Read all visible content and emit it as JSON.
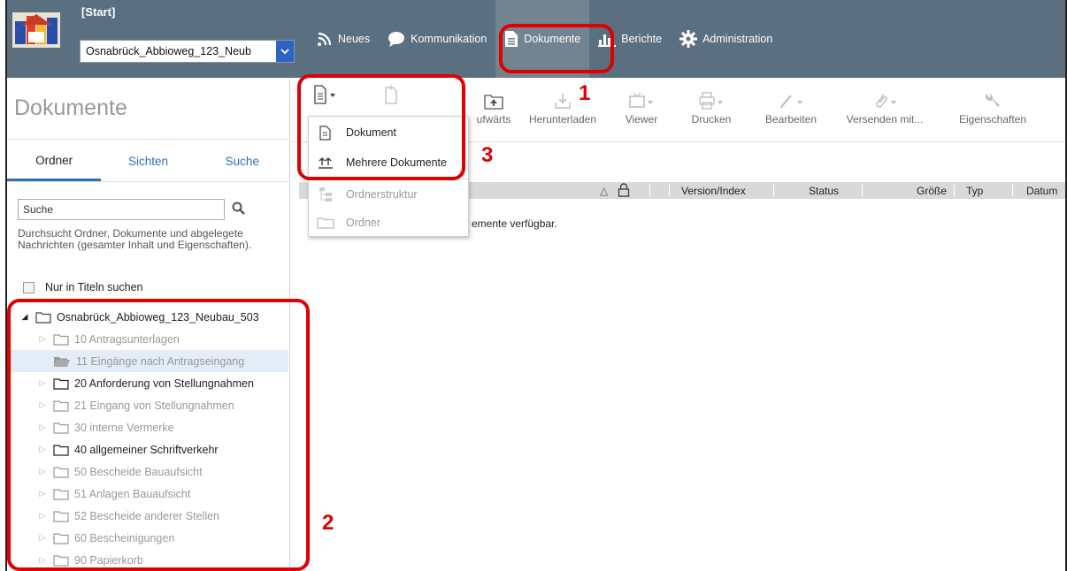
{
  "header": {
    "start_label": "[Start]",
    "project_select_value": "Osnabrück_Abbioweg_123_Neub",
    "nav": [
      {
        "label": "Neues",
        "icon": "rss-icon"
      },
      {
        "label": "Kommunikation",
        "icon": "speech-bubble-icon"
      },
      {
        "label": "Dokumente",
        "icon": "document-icon",
        "active": true
      },
      {
        "label": "Berichte",
        "icon": "bar-chart-icon"
      },
      {
        "label": "Administration",
        "icon": "gear-icon"
      }
    ]
  },
  "left_panel": {
    "title": "Dokumente",
    "tabs": [
      "Ordner",
      "Sichten",
      "Suche"
    ],
    "search_value": "Suche",
    "search_hint": "Durchsucht Ordner, Dokumente und abgelegete Nachrichten (gesamter Inhalt und Eigenschaften).",
    "title_only_label": "Nur in Titeln suchen",
    "tree": {
      "root": "Osnabrück_Abbioweg_123_Neubau_503",
      "children": [
        "10 Antragsunterlagen",
        "11 Eingänge nach Antragseingang",
        "20 Anforderung von Stellungnahmen",
        "21 Eingang von Stellungnahmen",
        "30 interne Vermerke",
        "40 allgemeiner Schriftverkehr",
        "50 Bescheide Bauaufsicht",
        "51 Anlagen Bauaufsicht",
        "52 Bescheide anderer Stellen",
        "60 Bescheinigungen",
        "90 Papierkorb"
      ]
    }
  },
  "toolbar": {
    "upload_label": "ufwärts",
    "download_label": "Herunterladen",
    "viewer_label": "Viewer",
    "print_label": "Drucken",
    "edit_label": "Bearbeiten",
    "send_label": "Versenden mit...",
    "properties_label": "Eigenschaften"
  },
  "new_menu": {
    "items": [
      "Dokument",
      "Mehrere Dokumente",
      "Ordnerstruktur",
      "Ordner"
    ]
  },
  "table": {
    "columns": [
      "Version/Index",
      "Status",
      "Größe",
      "Typ",
      "Datum"
    ],
    "sort_indicator": "△",
    "empty_message": "emente verfügbar."
  },
  "annotations": {
    "label_1": "1",
    "label_2": "2",
    "label_3": "3",
    "color": "#e00000"
  },
  "colors": {
    "header_bg": "#5a6f7f",
    "accent": "#2d6fc2"
  }
}
